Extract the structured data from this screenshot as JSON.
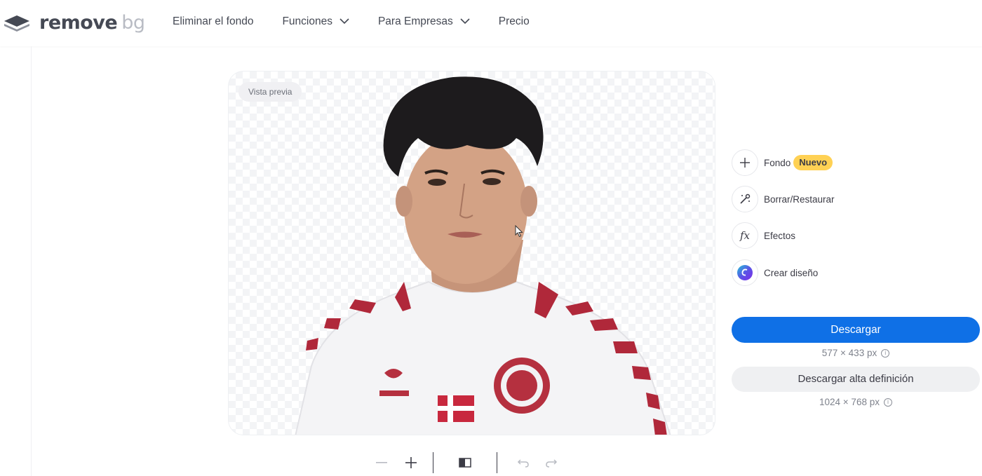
{
  "header": {
    "logo_remove": "remove",
    "logo_bg": "bg",
    "nav": [
      {
        "label": "Eliminar el fondo",
        "dropdown": false
      },
      {
        "label": "Funciones",
        "dropdown": true
      },
      {
        "label": "Para Empresas",
        "dropdown": true
      },
      {
        "label": "Precio",
        "dropdown": false
      }
    ]
  },
  "preview": {
    "badge": "Vista previa"
  },
  "tools": {
    "background": {
      "label": "Fondo",
      "badge": "Nuevo",
      "icon": "plus-icon"
    },
    "erase_restore": {
      "label": "Borrar/Restaurar",
      "icon": "magic-brush-icon"
    },
    "effects": {
      "label": "Efectos",
      "icon": "fx-icon"
    },
    "create_design": {
      "label": "Crear diseño",
      "icon": "canva-icon"
    }
  },
  "download": {
    "primary_label": "Descargar",
    "primary_size": "577 × 433 px",
    "hd_label": "Descargar alta definición",
    "hd_size": "1024 × 768 px"
  },
  "toolbar": {
    "items": [
      "zoom-out-icon",
      "zoom-in-icon",
      "compare-icon",
      "undo-icon",
      "redo-icon"
    ]
  },
  "colors": {
    "primary": "#0f70e6",
    "badge_new": "#ffd154",
    "text": "#3b3b45",
    "jersey_red": "#b0283a"
  }
}
